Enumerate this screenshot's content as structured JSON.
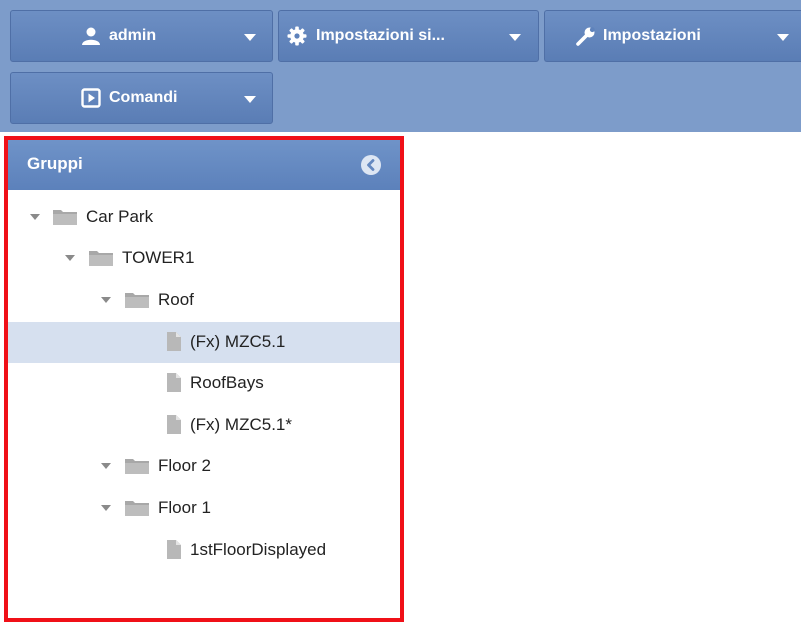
{
  "colors": {
    "toolbar_bg": "#7d9cca",
    "button_bg": "#5e82bb",
    "panel_header": "#6488c0",
    "selection": "#d6e0ef",
    "highlight_outline": "#f01018"
  },
  "toolbar": {
    "buttons": [
      {
        "icon": "user-icon",
        "label": "admin"
      },
      {
        "icon": "gear-icon",
        "label": "Impostazioni si..."
      },
      {
        "icon": "wrench-icon",
        "label": "Impostazioni"
      },
      {
        "icon": "play-box-icon",
        "label": "Comandi"
      }
    ]
  },
  "panel": {
    "title": "Gruppi",
    "collapse_icon": "chevron-left-circle-icon",
    "tree": [
      {
        "type": "folder",
        "label": "Car Park",
        "expanded": true
      },
      {
        "type": "folder",
        "label": "TOWER1",
        "expanded": true
      },
      {
        "type": "folder",
        "label": "Roof",
        "expanded": true
      },
      {
        "type": "file",
        "label": "(Fx) MZC5.1",
        "selected": true
      },
      {
        "type": "file",
        "label": "RoofBays"
      },
      {
        "type": "file",
        "label": "(Fx) MZC5.1*"
      },
      {
        "type": "folder",
        "label": "Floor 2",
        "expanded": true
      },
      {
        "type": "folder",
        "label": "Floor 1",
        "expanded": true
      },
      {
        "type": "file",
        "label": "1stFloorDisplayed"
      }
    ]
  }
}
